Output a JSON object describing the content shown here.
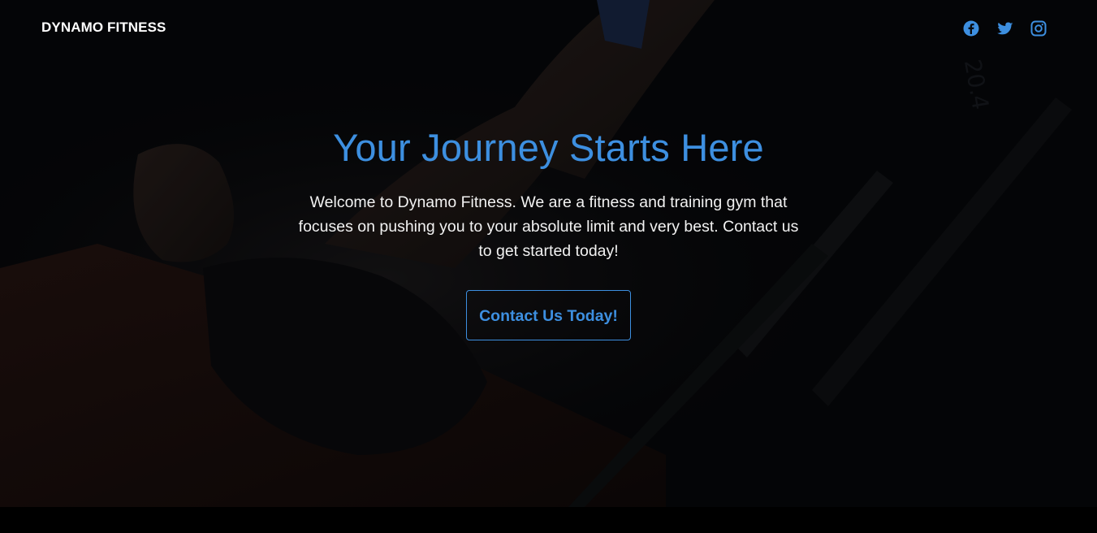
{
  "navbar": {
    "brand": "DYNAMO FITNESS",
    "social": [
      {
        "icon": "facebook-icon",
        "color": "#3d8fe0"
      },
      {
        "icon": "twitter-icon",
        "color": "#3d8fe0"
      },
      {
        "icon": "instagram-icon",
        "color": "#3d8fe0"
      }
    ]
  },
  "hero": {
    "title": "Your Journey Starts Here",
    "description": "Welcome to Dynamo Fitness. We are a fitness and training gym that focuses on pushing you to your absolute limit and very best. Contact us to get started today!",
    "cta_label": "Contact Us Today!"
  },
  "colors": {
    "accent": "#3d8fe0",
    "background": "#08090c",
    "text": "#f2f2f2"
  }
}
